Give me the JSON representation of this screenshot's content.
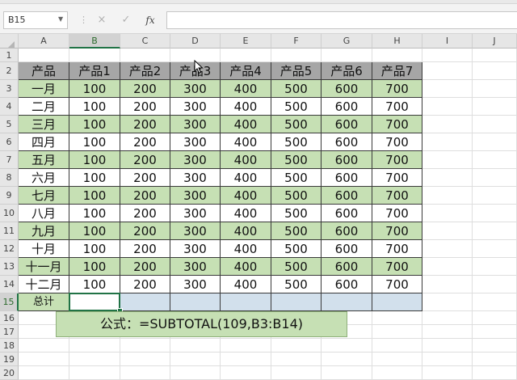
{
  "namebox": {
    "value": "B15"
  },
  "toolbar": {
    "cancel": "×",
    "enter": "✓",
    "fx": "fx"
  },
  "formula_bar": {
    "value": ""
  },
  "columns": [
    "A",
    "B",
    "C",
    "D",
    "E",
    "F",
    "G",
    "H",
    "I",
    "J"
  ],
  "rows": [
    "1",
    "2",
    "3",
    "4",
    "5",
    "6",
    "7",
    "8",
    "9",
    "10",
    "11",
    "12",
    "13",
    "14",
    "15",
    "16",
    "17",
    "18",
    "19",
    "20"
  ],
  "headers": [
    "产品",
    "产品1",
    "产品2",
    "产品3",
    "产品4",
    "产品5",
    "产品6",
    "产品7"
  ],
  "months": [
    "一月",
    "二月",
    "三月",
    "四月",
    "五月",
    "六月",
    "七月",
    "八月",
    "九月",
    "十月",
    "十一月",
    "十二月"
  ],
  "values": [
    "100",
    "200",
    "300",
    "400",
    "500",
    "600",
    "700"
  ],
  "total_label": "总计",
  "selected_cell": "B15",
  "formula_note": "公式：=SUBTOTAL(109,B3:B14)",
  "colors": {
    "header_fill": "#a6a6a6",
    "green_fill": "#c6e0b4",
    "blue_fill": "#d2e0ec",
    "selection": "#217346"
  }
}
